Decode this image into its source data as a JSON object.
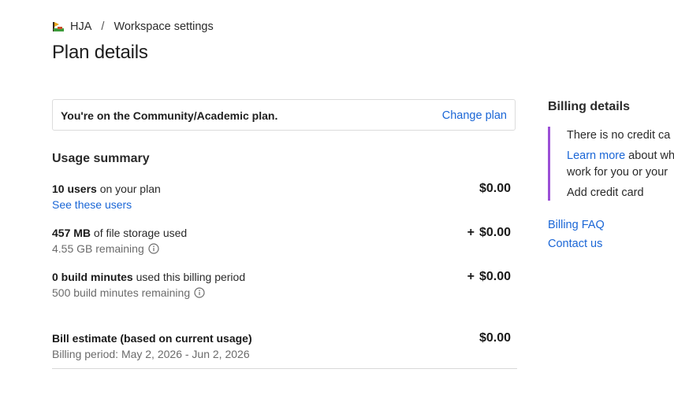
{
  "breadcrumb": {
    "workspace": "HJA",
    "separator": "/",
    "current": "Workspace settings"
  },
  "page": {
    "title": "Plan details"
  },
  "plan": {
    "text": "You're on the Community/Academic plan.",
    "change_label": "Change plan"
  },
  "usage": {
    "title": "Usage summary",
    "users": {
      "bold": "10 users",
      "rest": " on your plan",
      "link": "See these users",
      "amount": "$0.00"
    },
    "storage": {
      "bold": "457 MB",
      "rest": " of file storage used",
      "sub": "4.55 GB remaining",
      "plus": "+",
      "amount": "$0.00"
    },
    "build": {
      "bold": "0 build minutes",
      "rest": " used this billing period",
      "sub": "500 build minutes remaining",
      "plus": "+",
      "amount": "$0.00"
    },
    "estimate": {
      "label": "Bill estimate (based on current usage)",
      "period": "Billing period: May 2, 2026 - Jun 2, 2026",
      "amount": "$0.00"
    }
  },
  "billing": {
    "title": "Billing details",
    "notice_line1": "There is no credit ca",
    "learn_more": "Learn more",
    "notice_line2_rest": " about wh",
    "notice_line3": "work for you or your",
    "add_card": "Add credit card",
    "faq": "Billing FAQ",
    "contact": "Contact us"
  },
  "colors": {
    "link": "#1a66d6",
    "notice_border": "#9b4fd6"
  }
}
